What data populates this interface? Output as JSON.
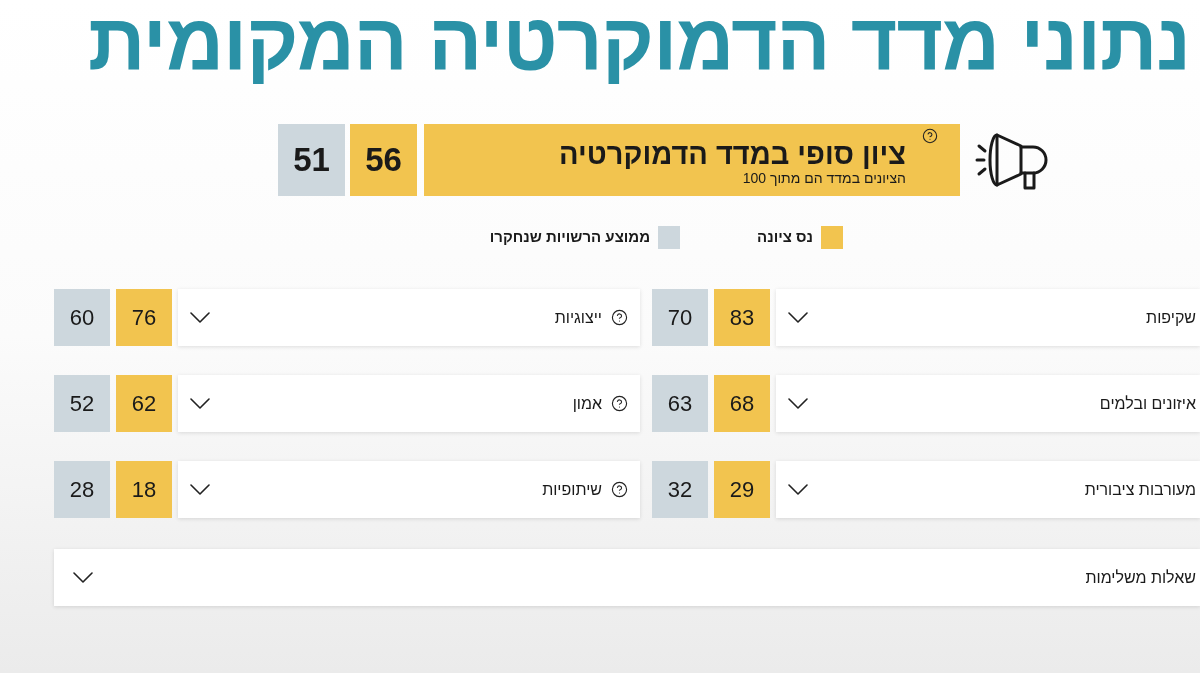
{
  "title": "נתוני מדד הדמוקרטיה המקומית",
  "final_score": {
    "title": "ציון סופי במדד הדמוקרטיה",
    "subtitle": "הציונים במדד הם מתוך 100",
    "help_icon": true,
    "scores": [
      "56",
      "51"
    ]
  },
  "legend": [
    {
      "label": "נס ציונה",
      "color": "#f2c44f"
    },
    {
      "label": "ממוצע הרשויות שנחקרו",
      "color": "#cdd7dd"
    }
  ],
  "categories": [
    {
      "label": "שקיפות",
      "help_icon": false,
      "expanded": false,
      "scores": [
        "83",
        "70"
      ]
    },
    {
      "label": "ייצוגיות",
      "help_icon": true,
      "expanded": false,
      "scores": [
        "76",
        "60"
      ]
    },
    {
      "label": "איזונים ובלמים",
      "help_icon": false,
      "expanded": false,
      "scores": [
        "68",
        "63"
      ]
    },
    {
      "label": "אמון",
      "help_icon": true,
      "expanded": false,
      "scores": [
        "62",
        "52"
      ]
    },
    {
      "label": "מעורבות ציבורית",
      "help_icon": false,
      "expanded": false,
      "scores": [
        "29",
        "32"
      ]
    },
    {
      "label": "שיתופיות",
      "help_icon": true,
      "expanded": false,
      "scores": [
        "18",
        "28"
      ]
    }
  ],
  "extra_questions": {
    "label": "שאלות משלימות",
    "expanded": false
  }
}
